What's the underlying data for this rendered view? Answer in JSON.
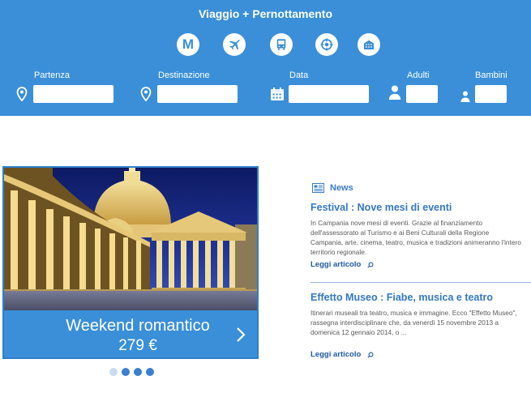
{
  "search": {
    "title": "Viaggio + Pernottamento",
    "modes": [
      {
        "icon": "metro-icon",
        "text": "M"
      },
      {
        "icon": "plane-icon"
      },
      {
        "icon": "bus-icon"
      },
      {
        "icon": "ferry-wheel-icon"
      },
      {
        "icon": "hotel-icon"
      }
    ],
    "fields": {
      "departure": {
        "label": "Partenza",
        "value": ""
      },
      "destination": {
        "label": "Destinazione",
        "value": ""
      },
      "date": {
        "label": "Data",
        "value": ""
      },
      "adults": {
        "label": "Adulti",
        "value": ""
      },
      "children": {
        "label": "Bambini",
        "value": ""
      }
    }
  },
  "promo": {
    "title": "Weekend romantico",
    "price": "279 €",
    "slides_total": 4,
    "active_slide": 1
  },
  "news": {
    "heading": "News",
    "articles": [
      {
        "title": "Festival : Nove mesi di eventi",
        "body": "In Campania nove mesi di eventi. Grazie al finanziamento dell'assessorato al Turismo e ai Beni Culturali della Regione Campania, arte, cinema, teatro, musica e tradizioni animeranno l'intero territorio regionale.",
        "read_more": "Leggi articolo"
      },
      {
        "title": "Effetto Museo : Fiabe, musica e teatro",
        "body": "Itinerari museali tra teatro, musica e immagine. Ecco \"Effetto Museo\", rassegna interdisciplinare che, da venerdì 15 novembre 2013 a domenica 12 gennaio 2014, o ...",
        "read_more": "Leggi articolo"
      }
    ]
  },
  "colors": {
    "primary": "#3a8fd8",
    "link": "#3478c0",
    "body_text": "#5a5a5a"
  }
}
